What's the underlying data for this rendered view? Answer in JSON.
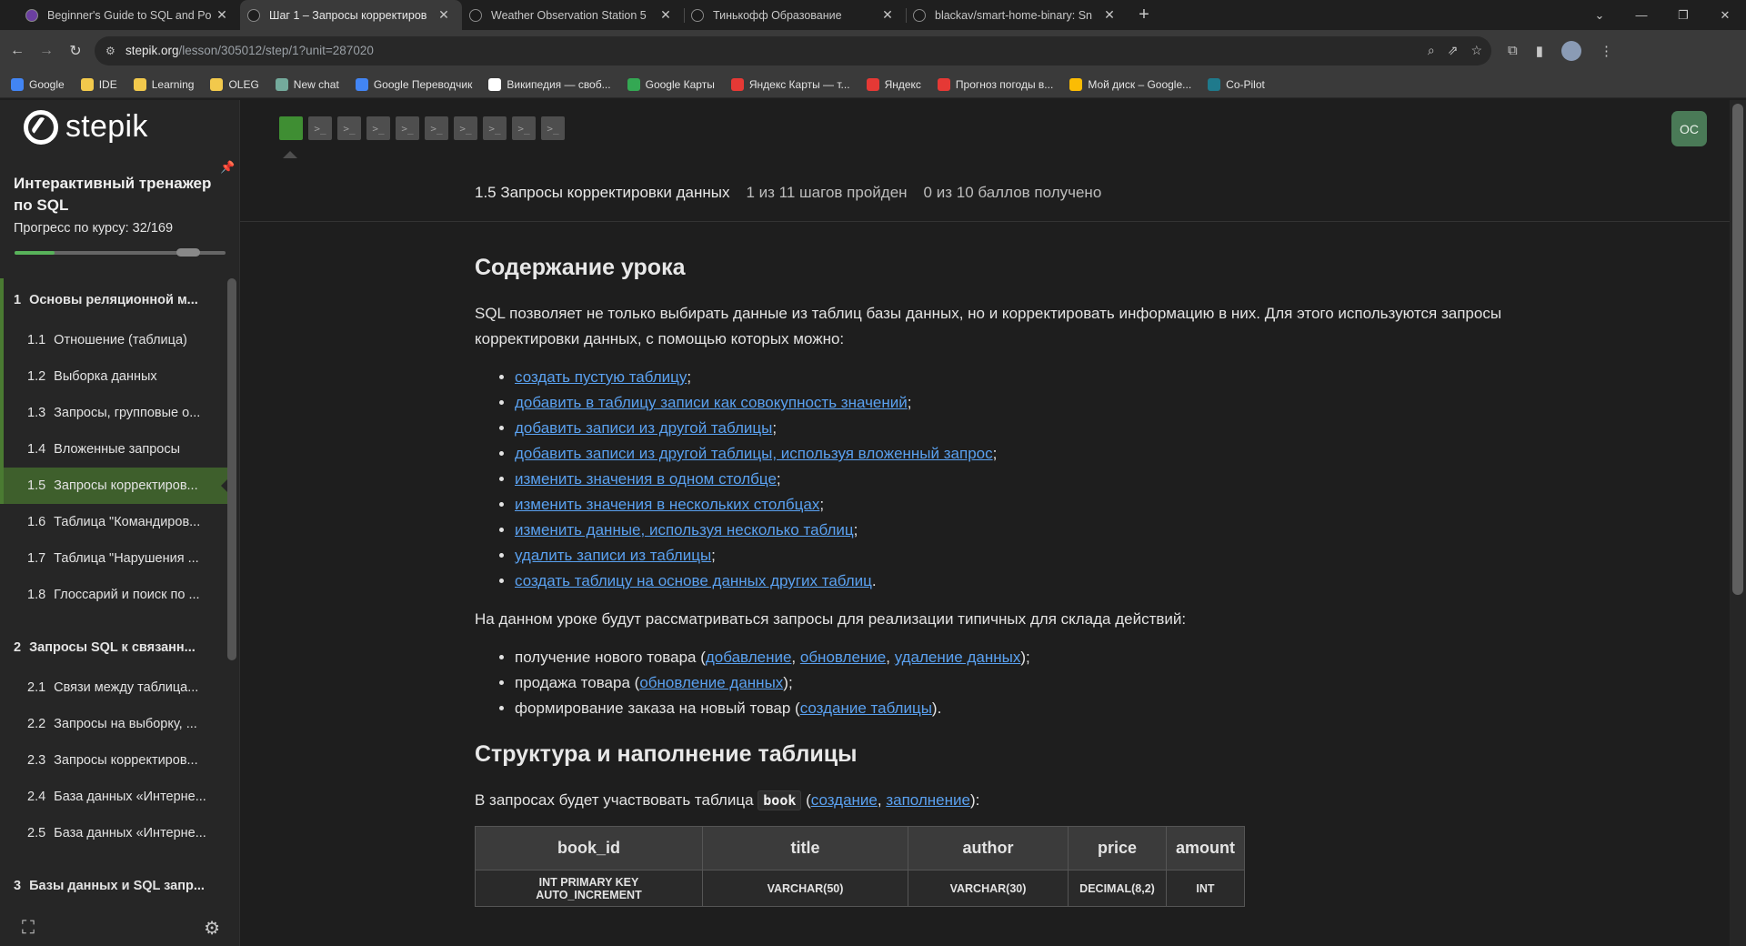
{
  "browser": {
    "tabs": [
      {
        "title": "Beginner's Guide to SQL and Po",
        "icon": "twitch-like-icon",
        "color": "#6b3fa0",
        "active": false
      },
      {
        "title": "Шаг 1 – Запросы корректиров",
        "icon": "stepik-icon",
        "color": "#1e1e1e",
        "active": true
      },
      {
        "title": "Weather Observation Station 5",
        "icon": "hackerrank-icon",
        "color": "#1a1a1a",
        "active": false
      },
      {
        "title": "Тинькофф Образование",
        "icon": "tinkoff-icon",
        "color": "#1a1a1a",
        "active": false
      },
      {
        "title": "blackav/smart-home-binary: Sn",
        "icon": "github-icon",
        "color": "#1a1a1a",
        "active": false
      }
    ],
    "new_tab": "+",
    "url_host": "stepik.org",
    "url_path": "/lesson/305012/step/1?unit=287020",
    "bookmarks": [
      {
        "label": "Google",
        "color": "#4285f4"
      },
      {
        "label": "IDE",
        "color": "#f2c94c"
      },
      {
        "label": "Learning",
        "color": "#f2c94c"
      },
      {
        "label": "OLEG",
        "color": "#f2c94c"
      },
      {
        "label": "New chat",
        "color": "#74aa9c"
      },
      {
        "label": "Google Переводчик",
        "color": "#4285f4"
      },
      {
        "label": "Википедия — своб...",
        "color": "#ffffff"
      },
      {
        "label": "Google Карты",
        "color": "#34a853"
      },
      {
        "label": "Яндекс Карты — т...",
        "color": "#e53935"
      },
      {
        "label": "Яндекс",
        "color": "#e53935"
      },
      {
        "label": "Прогноз погоды в...",
        "color": "#e53935"
      },
      {
        "label": "Мой диск – Google...",
        "color": "#fbbc04"
      },
      {
        "label": "Co-Pilot",
        "color": "#1f7a8c"
      }
    ]
  },
  "sidebar": {
    "logo": "stepik",
    "course_title": "Интерактивный тренажер по SQL",
    "progress_label": "Прогресс по курсу:",
    "progress_value": "32/169",
    "progress_fraction": 0.19,
    "toc": [
      {
        "kind": "module",
        "num": "1",
        "label": "Основы реляционной м...",
        "done": true
      },
      {
        "kind": "lesson",
        "num": "1.1",
        "label": "Отношение (таблица)",
        "done": true
      },
      {
        "kind": "lesson",
        "num": "1.2",
        "label": "Выборка данных",
        "done": true
      },
      {
        "kind": "lesson",
        "num": "1.3",
        "label": "Запросы, групповые о...",
        "done": true
      },
      {
        "kind": "lesson",
        "num": "1.4",
        "label": "Вложенные запросы",
        "done": true
      },
      {
        "kind": "lesson",
        "num": "1.5",
        "label": "Запросы корректиров...",
        "done": true,
        "current": true
      },
      {
        "kind": "lesson",
        "num": "1.6",
        "label": "Таблица \"Командиров...",
        "done": false
      },
      {
        "kind": "lesson",
        "num": "1.7",
        "label": "Таблица \"Нарушения ...",
        "done": false
      },
      {
        "kind": "lesson",
        "num": "1.8",
        "label": "Глоссарий и поиск по ...",
        "done": false
      },
      {
        "kind": "module",
        "num": "2",
        "label": "Запросы SQL к связанн...",
        "done": false
      },
      {
        "kind": "lesson",
        "num": "2.1",
        "label": "Связи между таблица...",
        "done": false
      },
      {
        "kind": "lesson",
        "num": "2.2",
        "label": "Запросы на выборку, ...",
        "done": false
      },
      {
        "kind": "lesson",
        "num": "2.3",
        "label": "Запросы корректиров...",
        "done": false
      },
      {
        "kind": "lesson",
        "num": "2.4",
        "label": "База данных «Интерне...",
        "done": false
      },
      {
        "kind": "lesson",
        "num": "2.5",
        "label": "База данных «Интерне...",
        "done": false
      },
      {
        "kind": "module",
        "num": "3",
        "label": "Базы данных и SQL запр...",
        "done": false
      }
    ]
  },
  "steps": {
    "count": 11,
    "active_index": 0,
    "caret_glyph": ">_"
  },
  "avatar": "OC",
  "lesson_header": {
    "title": "1.5 Запросы корректировки данных",
    "steps_passed": "1 из 11 шагов пройден",
    "points": "0 из 10 баллов  получено"
  },
  "content": {
    "h1": "Содержание урока",
    "intro": "SQL позволяет не только выбирать данные из таблиц базы данных, но и корректировать информацию в них. Для этого используются запросы корректировки данных, с помощью которых можно:",
    "list1": [
      {
        "link": "создать пустую таблицу",
        "tail": ";"
      },
      {
        "link": "добавить в таблицу записи как совокупность значений",
        "tail": ";"
      },
      {
        "link": "добавить записи из другой таблицы",
        "tail": ";"
      },
      {
        "link": "добавить записи из другой таблицы, используя вложенный запрос",
        "tail": ";"
      },
      {
        "link": "изменить значения в одном столбце",
        "tail": ";"
      },
      {
        "link": "изменить значения в нескольких столбцах",
        "tail": ";"
      },
      {
        "link": "изменить данные, используя несколько таблиц",
        "tail": ";"
      },
      {
        "link": "удалить записи из таблицы",
        "tail": ";"
      },
      {
        "link": "создать таблицу на основе данных других таблиц",
        "tail": "."
      }
    ],
    "para2": "На данном уроке будут рассматриваться запросы для реализации типичных для склада действий:",
    "list2": [
      {
        "pre": "получение нового товара (",
        "links": [
          "добавление",
          "обновление",
          "удаление данных"
        ],
        "post": ");"
      },
      {
        "pre": "продажа товара (",
        "links": [
          "обновление данных"
        ],
        "post": ");"
      },
      {
        "pre": "формирование заказа на новый товар (",
        "links": [
          "создание таблицы"
        ],
        "post": ")."
      }
    ],
    "h2": "Структура и наполнение таблицы",
    "para3_pre": "В запросах будет участвовать таблица",
    "para3_code": "book",
    "para3_links": [
      "создание",
      "заполнение"
    ],
    "table_headers": [
      "book_id",
      "title",
      "author",
      "price",
      "amount"
    ],
    "table_types": [
      "INT PRIMARY KEY AUTO_INCREMENT",
      "VARCHAR(50)",
      "VARCHAR(30)",
      "DECIMAL(8,2)",
      "INT"
    ]
  }
}
